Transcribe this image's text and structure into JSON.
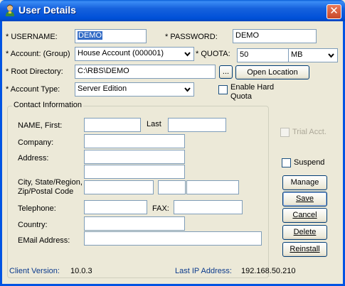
{
  "window": {
    "title": "User Details",
    "icon": "user-icon"
  },
  "fields": {
    "username_label": "* USERNAME:",
    "username_value": "DEMO",
    "password_label": "* PASSWORD:",
    "password_value": "DEMO",
    "account_label": "* Account: (Group)",
    "account_value": "House Account (000001)",
    "quota_label": "* QUOTA:",
    "quota_value": "50",
    "quota_unit": "MB",
    "root_label": "* Root Directory:",
    "root_value": "C:\\RBS\\DEMO",
    "browse_label": "...",
    "open_location_label": "Open Location",
    "account_type_label": "* Account Type:",
    "account_type_value": "Server Edition",
    "enable_hard_quota_label_1": "Enable Hard",
    "enable_hard_quota_label_2": "Quota"
  },
  "contact": {
    "group_title": "Contact Information",
    "name_first_label": "NAME, First:",
    "last_label": "Last",
    "company_label": "Company:",
    "address_label": "Address:",
    "city_label_1": "City, State/Region,",
    "city_label_2": "Zip/Postal Code",
    "telephone_label": "Telephone:",
    "fax_label": "FAX:",
    "country_label": "Country:",
    "email_label": "EMail Address:"
  },
  "options": {
    "trial_label": "Trial Acct.",
    "suspend_label": "Suspend"
  },
  "buttons": {
    "manage": "Manage",
    "save": "Save",
    "cancel": "Cancel",
    "delete": "Delete",
    "reinstall": "Reinstall"
  },
  "status": {
    "client_version_label": "Client Version:",
    "client_version_value": "10.0.3",
    "last_ip_label": "Last IP Address:",
    "last_ip_value": "192.168.50.210"
  }
}
